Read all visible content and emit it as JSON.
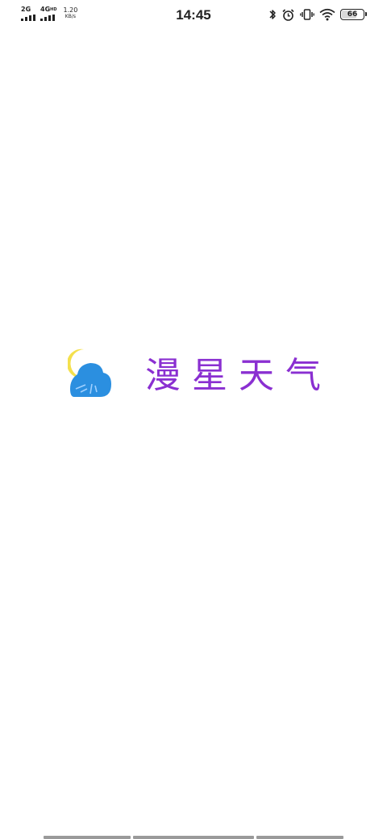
{
  "status_bar": {
    "sim1_network": "2G",
    "sim2_network": "4G",
    "sim2_network_suffix": "HD",
    "net_speed_value": "1.20",
    "net_speed_unit": "KB/s",
    "time": "14:45",
    "battery_level": "66",
    "battery_fraction": 0.66,
    "icons": [
      "bluetooth-icon",
      "alarm-icon",
      "vibrate-icon",
      "wifi-icon",
      "battery-icon"
    ]
  },
  "splash": {
    "app_name": "漫星天气",
    "logo_icon": "cloud-moon-logo-icon",
    "title_color": "#8a2fd1",
    "logo_colors": {
      "moon": "#f4e04d",
      "cloud": "#2b8fe0"
    }
  }
}
